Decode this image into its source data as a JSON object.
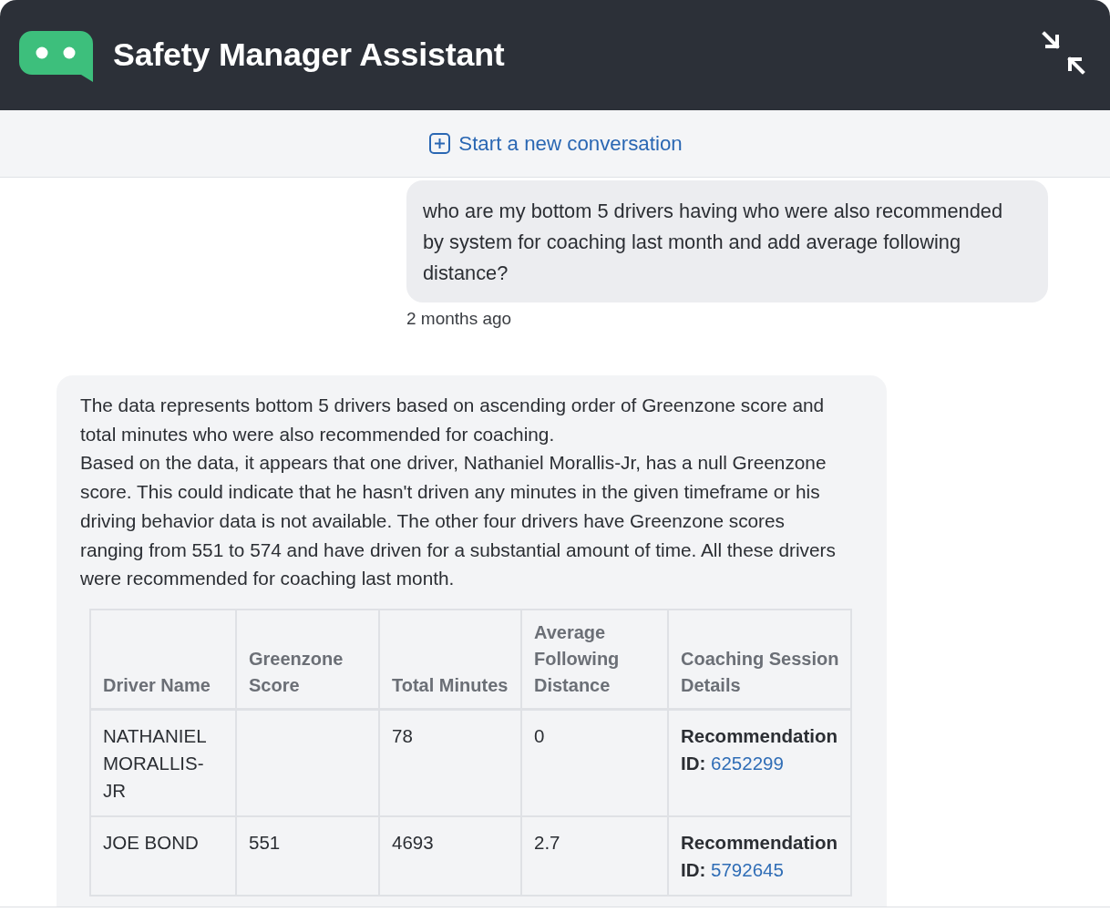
{
  "header": {
    "title": "Safety Manager Assistant"
  },
  "toolbar": {
    "link": "Start a new conversation"
  },
  "messages": [
    {
      "kind": "user",
      "text": "who are my bottom 5 drivers having who were also recommended by system for coaching last month and add average following distance?",
      "time": "2 months ago"
    },
    {
      "kind": "assistant",
      "paragraphs": [
        "The data represents bottom 5 drivers based on ascending order of Greenzone score and total minutes who were also recommended for coaching.",
        "Based on the data, it appears that one driver, Nathaniel Morallis-Jr, has a null Greenzone score. This could indicate that he hasn't driven any minutes in the given timeframe or his driving behavior data is not available. The other four drivers have Greenzone scores ranging from 551 to 574 and have driven for a substantial amount of time. All these drivers were recommended for coaching last month."
      ],
      "table": {
        "columns": [
          "Driver Name",
          "Greenzone Score",
          "Total Minutes",
          "Average Following Distance",
          "Coaching Session Details"
        ],
        "rows": [
          {
            "cells": [
              {
                "kind": "text",
                "text": "NATHANIEL MORALLIS-JR"
              },
              {
                "kind": "blank"
              },
              {
                "kind": "text",
                "text": "78"
              },
              {
                "kind": "text",
                "text": "0"
              },
              {
                "kind": "recommendation",
                "label": "Recommendation ID:",
                "link": "6252299"
              }
            ]
          },
          {
            "cells": [
              {
                "kind": "text",
                "text": "JOE BOND"
              },
              {
                "kind": "text",
                "text": "551"
              },
              {
                "kind": "text",
                "text": "4693"
              },
              {
                "kind": "text",
                "text": "2.7"
              },
              {
                "kind": "recommendation",
                "label": "Recommendation ID:",
                "link": "5792645"
              }
            ]
          }
        ]
      }
    }
  ]
}
